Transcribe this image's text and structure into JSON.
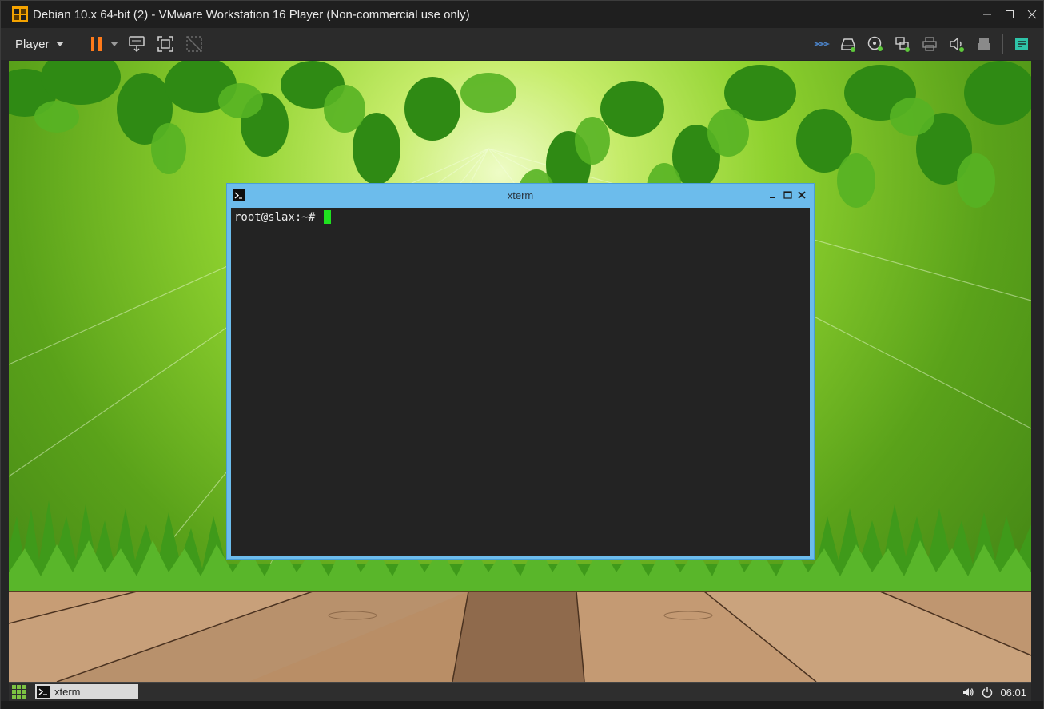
{
  "vmware": {
    "title": "Debian 10.x 64-bit (2) - VMware Workstation 16 Player (Non-commercial use only)",
    "menu_label": "Player",
    "toolbar_left_icons": [
      "pause-icon",
      "send-ctrl-alt-del-icon",
      "full-screen-icon",
      "unity-icon"
    ],
    "toolbar_right_icons": [
      "network-adapter-icon",
      "hard-disk-icon",
      "cd-dvd-icon",
      "usb-controller-icon",
      "printer-icon",
      "sound-card-icon",
      "display-icon",
      "message-log-icon"
    ],
    "colors": {
      "titlebar": "#1f1f1f",
      "toolbar": "#2b2b2b",
      "pause": "#ff7a1a",
      "accent": "#2ec4a8"
    }
  },
  "xterm": {
    "title": "xterm",
    "prompt": "root@slax:~# ",
    "cursor_color": "#1fe11f",
    "frame_color": "#6cbcec"
  },
  "taskbar": {
    "task_label": "xterm",
    "clock": "06:01"
  }
}
